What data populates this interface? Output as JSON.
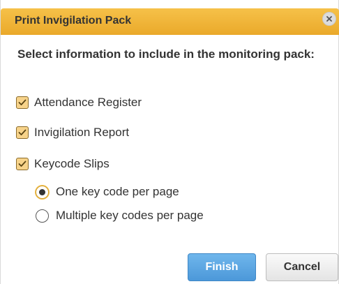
{
  "dialog": {
    "title": "Print Invigilation Pack",
    "instruction": "Select information to include in the monitoring pack:",
    "checkboxes": [
      {
        "label": "Attendance Register",
        "checked": true
      },
      {
        "label": "Invigilation Report",
        "checked": true
      },
      {
        "label": "Keycode Slips",
        "checked": true
      }
    ],
    "radios": [
      {
        "label": "One key code per page",
        "selected": true
      },
      {
        "label": "Multiple key codes per page",
        "selected": false
      }
    ],
    "buttons": {
      "finish": "Finish",
      "cancel": "Cancel"
    },
    "icons": {
      "close": "close-icon",
      "check": "checkmark-icon"
    },
    "colors": {
      "titlebar": "#eaa92a",
      "primary_button": "#4c98d9",
      "checkbox_fill": "#f7d38a"
    }
  }
}
